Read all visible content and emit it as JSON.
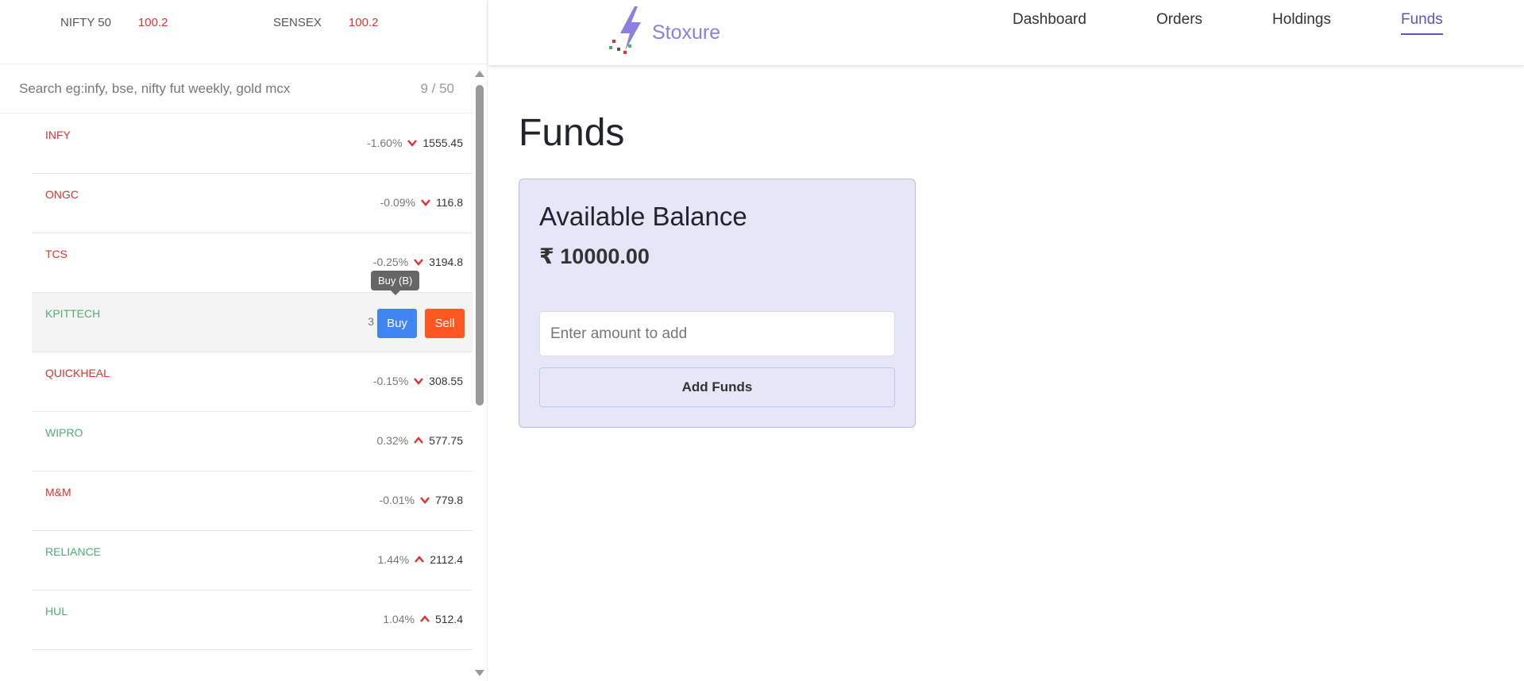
{
  "indices": [
    {
      "name": "NIFTY 50",
      "value": "100.2"
    },
    {
      "name": "SENSEX",
      "value": "100.2"
    }
  ],
  "search": {
    "placeholder": "Search eg:infy, bse, nifty fut weekly, gold mcx",
    "count": "9 / 50"
  },
  "watchlist": [
    {
      "symbol": "INFY",
      "change": "-1.60%",
      "price": "1555.45",
      "direction": "down"
    },
    {
      "symbol": "ONGC",
      "change": "-0.09%",
      "price": "116.8",
      "direction": "down"
    },
    {
      "symbol": "TCS",
      "change": "-0.25%",
      "price": "3194.8",
      "direction": "down"
    },
    {
      "symbol": "KPITTECH",
      "change": "3",
      "price": "",
      "direction": "up"
    },
    {
      "symbol": "QUICKHEAL",
      "change": "-0.15%",
      "price": "308.55",
      "direction": "down"
    },
    {
      "symbol": "WIPRO",
      "change": "0.32%",
      "price": "577.75",
      "direction": "up"
    },
    {
      "symbol": "M&M",
      "change": "-0.01%",
      "price": "779.8",
      "direction": "down"
    },
    {
      "symbol": "RELIANCE",
      "change": "1.44%",
      "price": "2112.4",
      "direction": "up"
    },
    {
      "symbol": "HUL",
      "change": "1.04%",
      "price": "512.4",
      "direction": "up"
    }
  ],
  "hover_actions": {
    "buy_label": "Buy",
    "sell_label": "Sell",
    "tooltip": "Buy (B)"
  },
  "logo": {
    "text": "Stoxure"
  },
  "nav": {
    "items": [
      {
        "label": "Dashboard"
      },
      {
        "label": "Orders"
      },
      {
        "label": "Holdings"
      },
      {
        "label": "Funds"
      }
    ],
    "active": "Funds"
  },
  "funds": {
    "page_title": "Funds",
    "card_title": "Available Balance",
    "balance": "₹ 10000.00",
    "amount_placeholder": "Enter amount to add",
    "add_button": "Add Funds"
  },
  "colors": {
    "down": "#e0322e",
    "up": "#4caf70",
    "accent": "#5c53c7",
    "buy": "#4184f3",
    "sell": "#ff5722",
    "card_bg": "#e5e6f7"
  }
}
